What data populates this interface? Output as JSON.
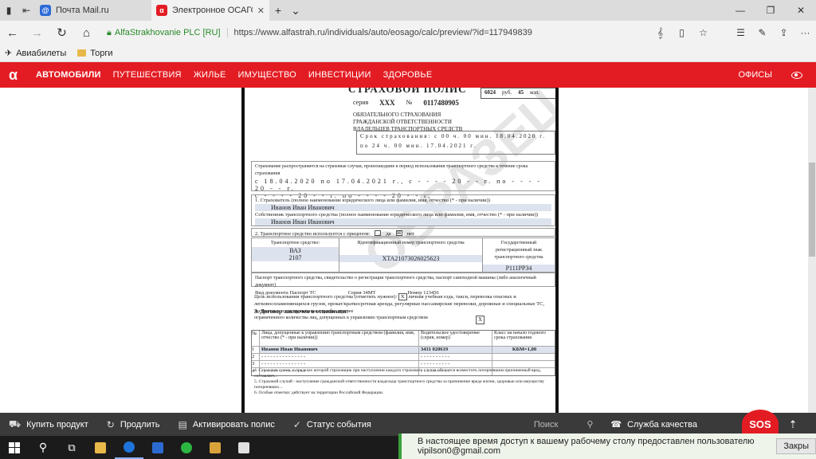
{
  "browser": {
    "tabs": [
      {
        "title": "Почта Mail.ru",
        "active": false
      },
      {
        "title": "Электронное ОСАГО",
        "active": true
      }
    ],
    "url_site_id": "AlfaStrakhovanie PLC [RU]",
    "url": "https://www.alfastrah.ru/individuals/auto/eosago/calc/preview/?id=117949839",
    "favorites": [
      "Авиабилеты",
      "Торги"
    ]
  },
  "site_nav": {
    "logo": "α",
    "items": [
      "АВТОМОБИЛИ",
      "ПУТЕШЕСТВИЯ",
      "ЖИЛЬЕ",
      "ИМУЩЕСТВО",
      "ИНВЕСТИЦИИ",
      "ЗДОРОВЬЕ"
    ],
    "offices": "ОФИСЫ"
  },
  "document": {
    "watermark": "ОБРАЗЕЦ",
    "title": "СТРАХОВОЙ ПОЛИС",
    "premium": "6024",
    "premium_unit": "руб.",
    "premium_kop": "45",
    "premium_kop_unit": "коп.",
    "series_label": "серия",
    "series": "ХХХ",
    "number_label": "№",
    "number": "0117480905",
    "osago_heading": [
      "ОБЯЗАТЕЛЬНОГО СТРАХОВАНИЯ",
      "ГРАЖДАНСКОЙ ОТВЕТСТВЕННОСТИ",
      "ВЛАДЕЛЬЦЕВ ТРАНСПОРТНЫХ СРЕДСТВ"
    ],
    "term_from": "Срок страхования: с 00 ч. 00 мин. 18.04.2020 г.",
    "term_to": "по 24 ч. 00 мин. 17.04.2021 г.",
    "period_line1": "Страхование распространяется на страховые случаи, произошедшие в период использования транспортного средства в течение срока страхования",
    "period_line2": "с 18.04.2020 по 17.04.2021 г., с - - - - 20 - - г. по - - - - 20 - - г.",
    "period_line3": "с - - - - 20 - - г. по - - - - 20 - - г.",
    "insurer_label": "1. Страхователь (полное наименование юридического лица или фамилия, имя, отчество (* - при наличии))",
    "insurer_name": "Иванов Иван Иванович",
    "owner_label": "Собственник транспортного средства (полное наименование юридического лица или фамилия, имя, отчество (* - при наличии))",
    "owner_name": "Иванов Иван Иванович",
    "trailer_label": "2. Транспортное средство используется с прицепом:",
    "trailer_yes": "да",
    "trailer_no": "нет",
    "vehicle_brand_label": "Транспортное средство:",
    "vehicle_brand": "ВАЗ",
    "vehicle_model": "2107",
    "vin_label": "Идентификационный номер транспортного средства",
    "vin": "XTA21073026025623",
    "reg_label": "Государственный регистрационный знак транспортного средства",
    "reg": "P111PP34",
    "passport_label": "Паспорт транспортного средства, свидетельство о регистрации транспортного средства, паспорт самоходной машины (либо аналогичный документ)",
    "doc_type": "Вид документа Паспорт ТС",
    "doc_series": "Серия 34МТ",
    "doc_number": "Номер 123456",
    "purpose_label": "Цель использования транспортного средства (отметить нужное):",
    "purpose_personal": "личная",
    "purpose_options": "учебная езда, такси, перевозка опасных и легковоспламеняющихся грузов, прокат/краткосрочная аренда, регулярные пассажирские перевозки, дорожные и специальные ТС, экстренные и коммунальные службы, прочее",
    "contract_heading": "3. Договор заключен в отношении:",
    "contract_limited": "ограниченного количества лиц, допущенных к управлению транспортным средством",
    "driver_table_head": [
      "№",
      "Лица, допущенные к управлению транспортным средством (фамилия, имя, отчество (* - при наличии))",
      "Водительское удостоверение (серия, номер)",
      "Класс на начало годового срока страхования"
    ],
    "drivers": [
      {
        "n": "1",
        "name": "Иванов Иван Иванович",
        "license": "3431 020619",
        "kbm": "КБМ=1,00"
      },
      {
        "n": "2",
        "name": "- - - - - - - - - - - - - - -",
        "license": "- - - -   - - - - - -",
        "kbm": ""
      },
      {
        "n": "3",
        "name": "- - - - - - - - - - - - - - -",
        "license": "- - - -   - - - - - -",
        "kbm": ""
      },
      {
        "n": "4",
        "name": "- - - - - - - - - - - - - - -",
        "license": "- - - -   - - - - - -",
        "kbm": ""
      }
    ],
    "notes": [
      "4. Страховая сумма, в пределах которой страховщик при наступлении каждого страхового случая обязуется возместить потерпевшим причиненный вред, составляет...",
      "5. Страховой случай - наступление гражданской ответственности владельца транспортного средства за причинение вреда жизни, здоровью или имуществу потерпевших...",
      "6. Особые отметки: действует на территории Российской Федерации."
    ]
  },
  "site_bottom": {
    "buy": "Купить продукт",
    "extend": "Продлить",
    "activate": "Активировать полис",
    "status": "Статус события",
    "search_placeholder": "Поиск",
    "quality": "Служба качества",
    "sos": "SOS"
  },
  "notification": {
    "text": "В настоящее время доступ к вашему рабочему столу предоставлен пользователю vipilson0@gmail.com",
    "button": "Закры"
  }
}
